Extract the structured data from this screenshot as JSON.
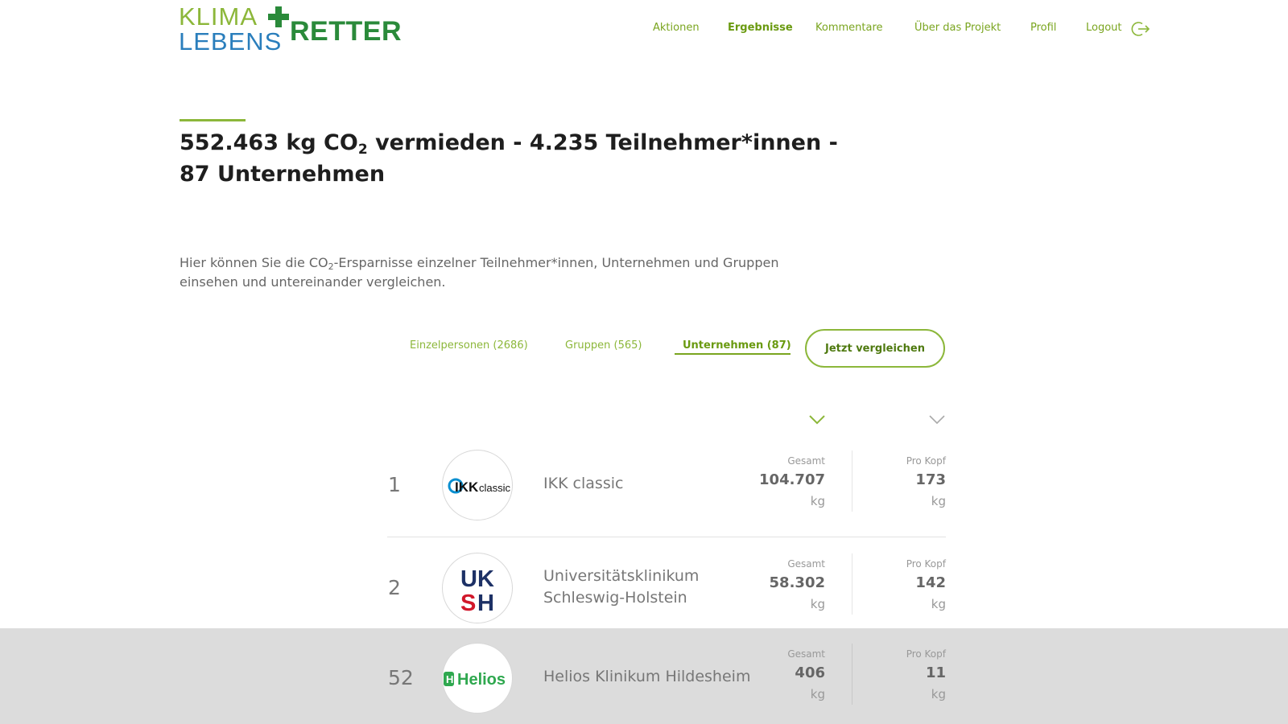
{
  "logo": {
    "klima": "KLIMA",
    "lebens": "LEBENS",
    "retter": "RETTER"
  },
  "nav": {
    "items": [
      {
        "label": "Aktionen",
        "active": false
      },
      {
        "label": "Ergebnisse",
        "active": true
      },
      {
        "label": "Kommentare",
        "active": false
      },
      {
        "label": "Über das Projekt",
        "active": false
      },
      {
        "label": "Profil",
        "active": false
      },
      {
        "label": "Logout",
        "active": false
      }
    ],
    "logout_icon": "logout-arrow-icon"
  },
  "headline": {
    "part1": "552.463 kg CO",
    "sub": "2",
    "part2": " vermieden - 4.235 Teilnehmer*innen - 87 Unternehmen"
  },
  "intro": {
    "part1": "Hier können Sie die CO",
    "sub": "2",
    "part2": "-Ersparnisse einzelner Teilnehmer*innen, Unternehmen und Gruppen einsehen und untereinander vergleichen."
  },
  "tabs": [
    {
      "label": "Einzelpersonen (2686)",
      "active": false
    },
    {
      "label": "Gruppen (565)",
      "active": false
    },
    {
      "label": "Unternehmen (87)",
      "active": true
    }
  ],
  "compare_button": "Jetzt vergleichen",
  "sort": {
    "total_icon": "chevron-down-icon",
    "per_head_icon": "chevron-down-icon"
  },
  "rows": [
    {
      "rank": "1",
      "logo": "IKK classic",
      "name": "IKK classic",
      "total_label": "Gesamt",
      "total": "104.707",
      "total_unit": "kg",
      "per_head_label": "Pro Kopf",
      "per_head": "173",
      "per_head_unit": "kg"
    },
    {
      "rank": "2",
      "logo": "UKSH",
      "name": "Universitätsklinikum Schleswig-Holstein",
      "total_label": "Gesamt",
      "total": "58.302",
      "total_unit": "kg",
      "per_head_label": "Pro Kopf",
      "per_head": "142",
      "per_head_unit": "kg"
    },
    {
      "rank": "52",
      "logo": "Helios",
      "name": "Helios Klinikum Hildesheim",
      "total_label": "Gesamt",
      "total": "406",
      "total_unit": "kg",
      "per_head_label": "Pro Kopf",
      "per_head": "11",
      "per_head_unit": "kg"
    }
  ],
  "colors": {
    "brand_green": "#8cb73a",
    "brand_dark_green": "#2a8a3a",
    "brand_blue": "#2a7ebc",
    "highlight_row": "#dcdcdc"
  }
}
